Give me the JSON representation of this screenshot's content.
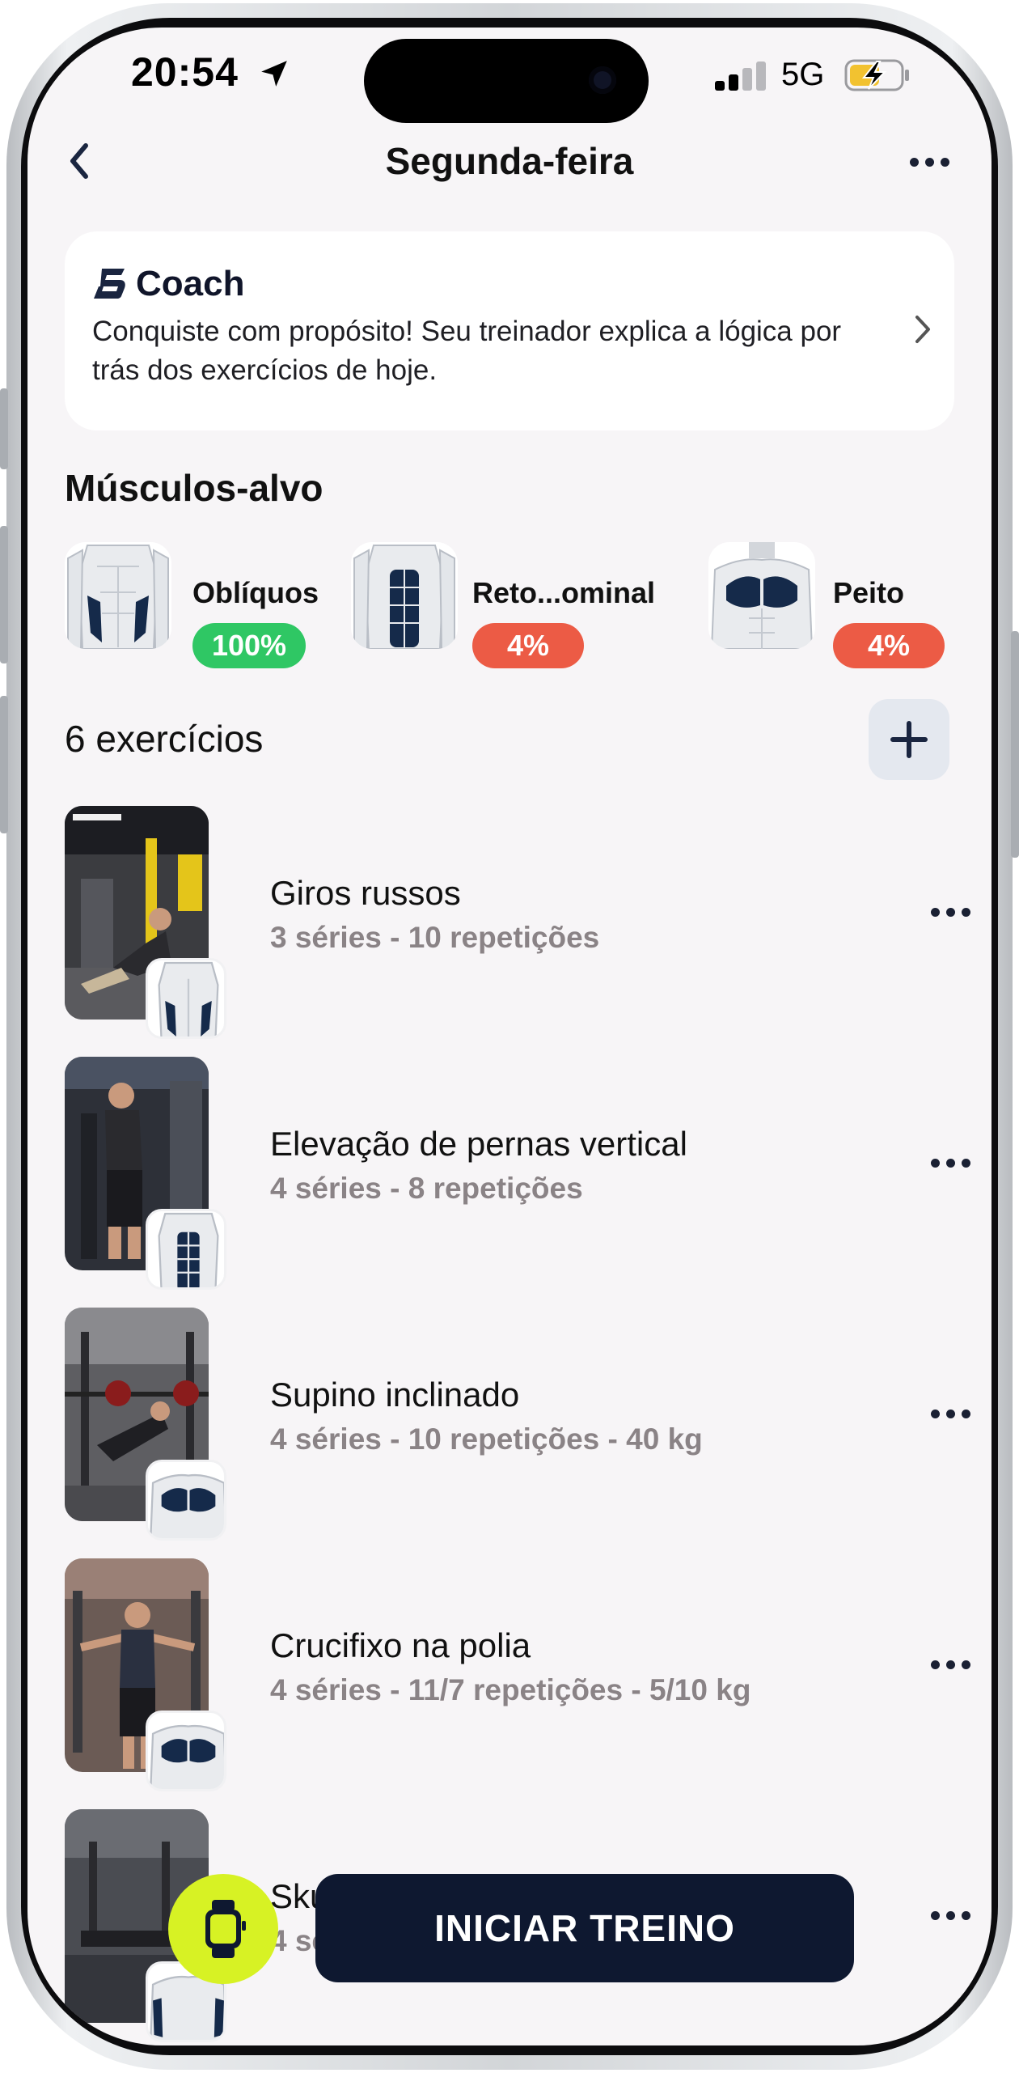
{
  "status_bar": {
    "time": "20:54",
    "network": "5G"
  },
  "nav": {
    "title": "Segunda-feira"
  },
  "coach": {
    "title": "Coach",
    "text": "Conquiste com propósito! Seu treinador explica a lógica por trás dos exercícios de hoje."
  },
  "target_muscles": {
    "title": "Músculos-alvo",
    "items": [
      {
        "name": "Oblíquos",
        "percent": "100%",
        "color": "#2fc764"
      },
      {
        "name": "Reto...ominal",
        "percent": "4%",
        "color": "#ec5b45"
      },
      {
        "name": "Peito",
        "percent": "4%",
        "color": "#ec5b45"
      }
    ]
  },
  "exercises": {
    "title": "6 exercícios",
    "items": [
      {
        "name": "Giros russos",
        "detail": "3 séries - 10 repetições"
      },
      {
        "name": "Elevação de pernas vertical",
        "detail": "4 séries - 8 repetições"
      },
      {
        "name": "Supino inclinado",
        "detail": "4 séries - 10 repetições - 40 kg"
      },
      {
        "name": "Crucifixo na polia",
        "detail": "4 séries - 11/7 repetições - 5/10 kg"
      },
      {
        "name": "Skul",
        "detail": "4 sér"
      }
    ]
  },
  "actions": {
    "start_label": "INICIAR TREINO"
  },
  "icons": {
    "back": "chevron-left-icon",
    "more": "more-horizontal-icon",
    "add": "plus-icon",
    "watch": "smartwatch-icon"
  },
  "colors": {
    "navy": "#0e1830",
    "accent_lime": "#d7f224",
    "muscle_fill": "#152a4a"
  }
}
